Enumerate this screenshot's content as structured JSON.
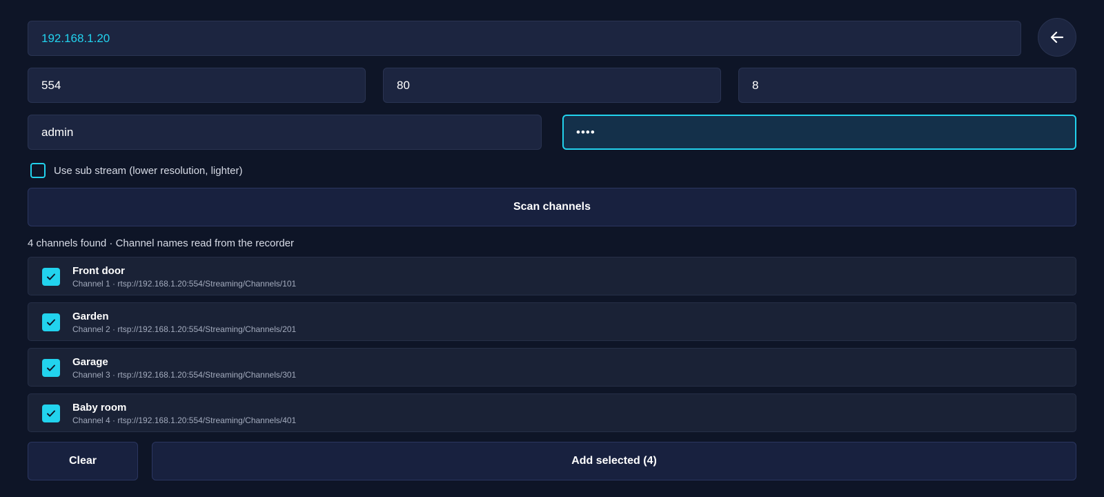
{
  "form": {
    "host": "192.168.1.20",
    "rtsp_port": "554",
    "http_port": "80",
    "channel_count": "8",
    "username": "admin",
    "password_masked": "••••"
  },
  "back_button": {
    "icon": "arrow-left-icon"
  },
  "sub_stream": {
    "label": "Use sub stream (lower resolution, lighter)",
    "checked": false
  },
  "scan_button": {
    "label": "Scan channels"
  },
  "status_text": "4 channels found · Channel names read from the recorder",
  "channels": [
    {
      "name": "Front door",
      "detail": "Channel 1 · rtsp://192.168.1.20:554/Streaming/Channels/101",
      "checked": true
    },
    {
      "name": "Garden",
      "detail": "Channel 2 · rtsp://192.168.1.20:554/Streaming/Channels/201",
      "checked": true
    },
    {
      "name": "Garage",
      "detail": "Channel 3 · rtsp://192.168.1.20:554/Streaming/Channels/301",
      "checked": true
    },
    {
      "name": "Baby room",
      "detail": "Channel 4 · rtsp://192.168.1.20:554/Streaming/Channels/401",
      "checked": true
    }
  ],
  "actions": {
    "clear_label": "Clear",
    "add_label": "Add selected (4)"
  },
  "colors": {
    "background": "#0e1527",
    "accent": "#22d3ee",
    "field": "#1c2540",
    "button": "#18213f"
  }
}
